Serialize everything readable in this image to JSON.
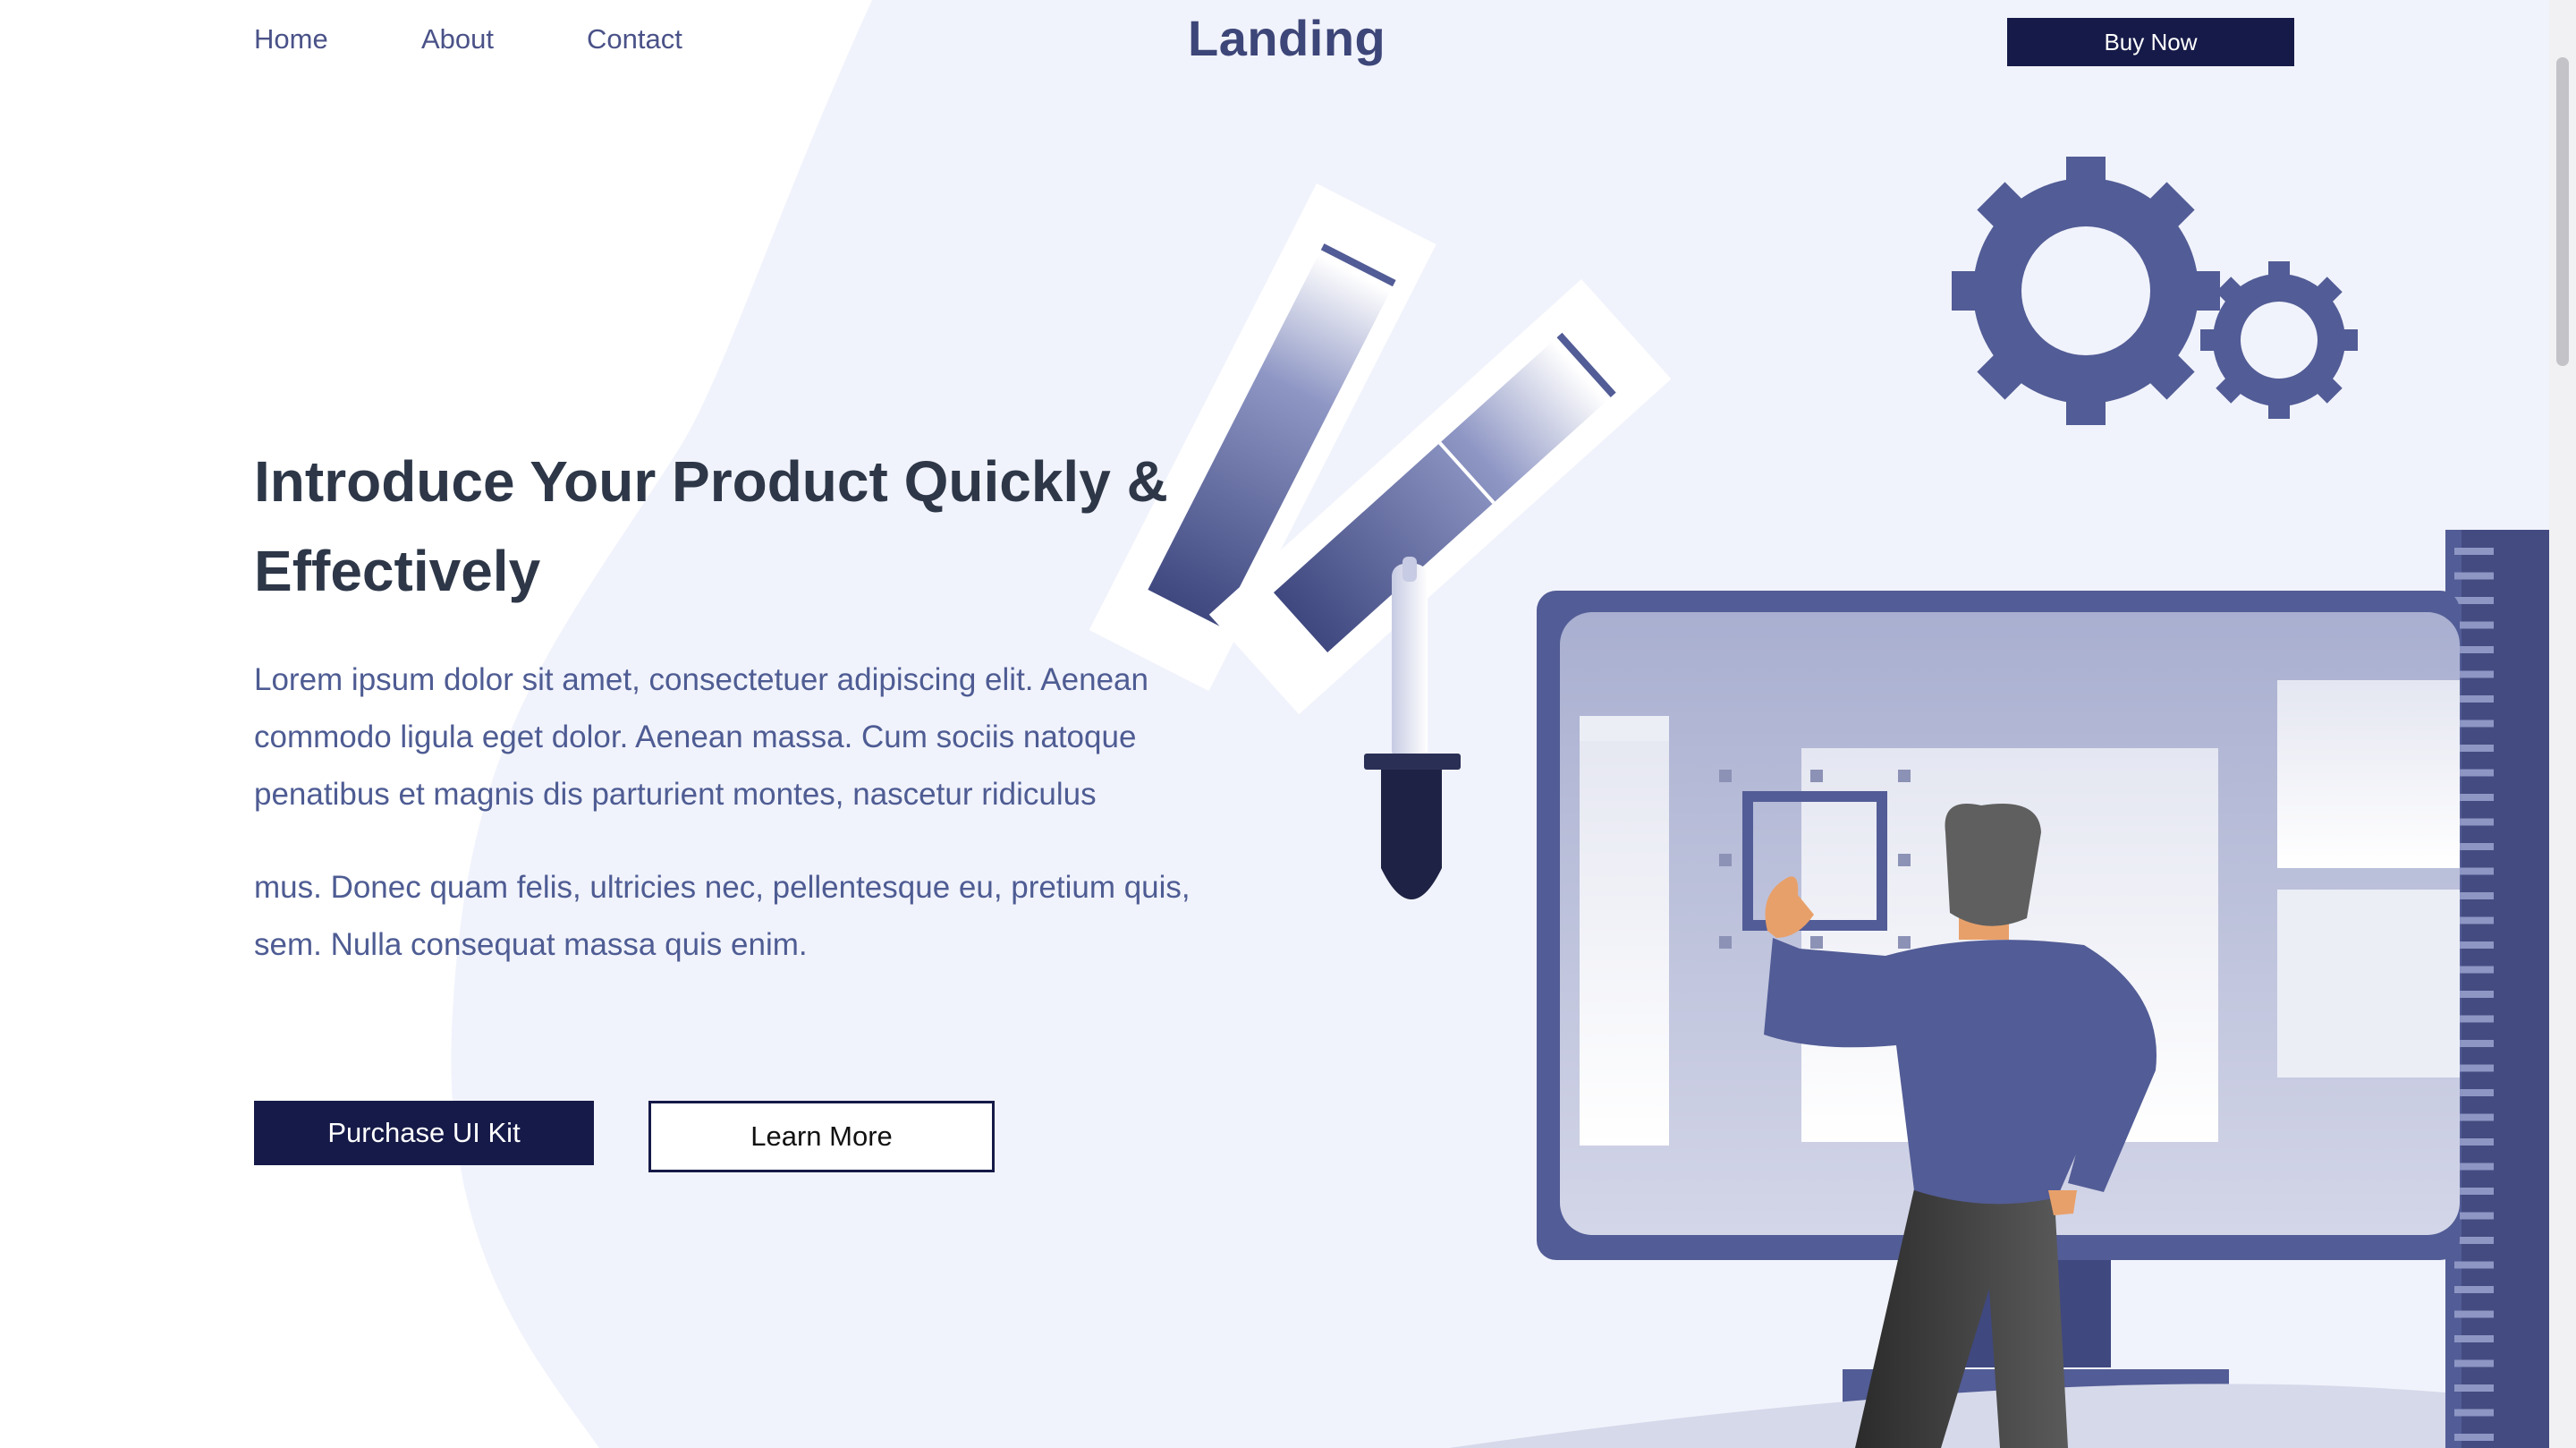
{
  "nav": {
    "links": [
      "Home",
      "About",
      "Contact"
    ],
    "brand": "Landing",
    "cta": "Buy Now"
  },
  "hero": {
    "title": "Introduce Your Product Quickly & Effectively",
    "paragraph1": "Lorem ipsum dolor sit amet, consectetuer adipiscing elit. Aenean commodo ligula eget dolor. Aenean massa. Cum sociis natoque penatibus et magnis dis parturient montes, nascetur ridiculus",
    "paragraph2": "mus. Donec quam felis, ultricies nec, pellentesque eu, pretium quis, sem. Nulla consequat massa quis enim.",
    "primary_button": "Purchase UI Kit",
    "secondary_button": "Learn More"
  },
  "colors": {
    "background": "#ffffff",
    "blob": "#f1f3fc",
    "accent_dark": "#151a48",
    "illustration": "#525c96",
    "heading": "#2d3748",
    "body_text": "#4e5c93"
  },
  "icons": {
    "gears": "gear-icon",
    "color_swatches": "color-palette-icon",
    "eyedropper": "eyedropper-icon"
  }
}
